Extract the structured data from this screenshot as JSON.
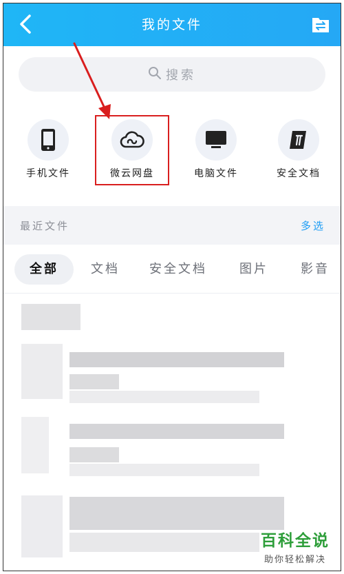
{
  "header": {
    "title": "我的文件",
    "back_icon": "back-chevron-icon",
    "action_icon": "transfer-icon"
  },
  "search": {
    "placeholder": "搜索",
    "icon": "search-icon"
  },
  "categories": [
    {
      "label": "手机文件",
      "icon": "phone-icon"
    },
    {
      "label": "微云网盘",
      "icon": "cloud-icon"
    },
    {
      "label": "电脑文件",
      "icon": "monitor-icon"
    },
    {
      "label": "安全文档",
      "icon": "secure-doc-icon"
    }
  ],
  "recent": {
    "title": "最近文件",
    "multi_select": "多选"
  },
  "tabs": [
    "全部",
    "文档",
    "安全文档",
    "图片",
    "影音"
  ],
  "watermark": {
    "main": "百科全说",
    "sub": "助你轻松解决"
  },
  "colors": {
    "header": "#25a8f5",
    "accent": "#1e9df5",
    "highlight": "#d91e1e"
  }
}
